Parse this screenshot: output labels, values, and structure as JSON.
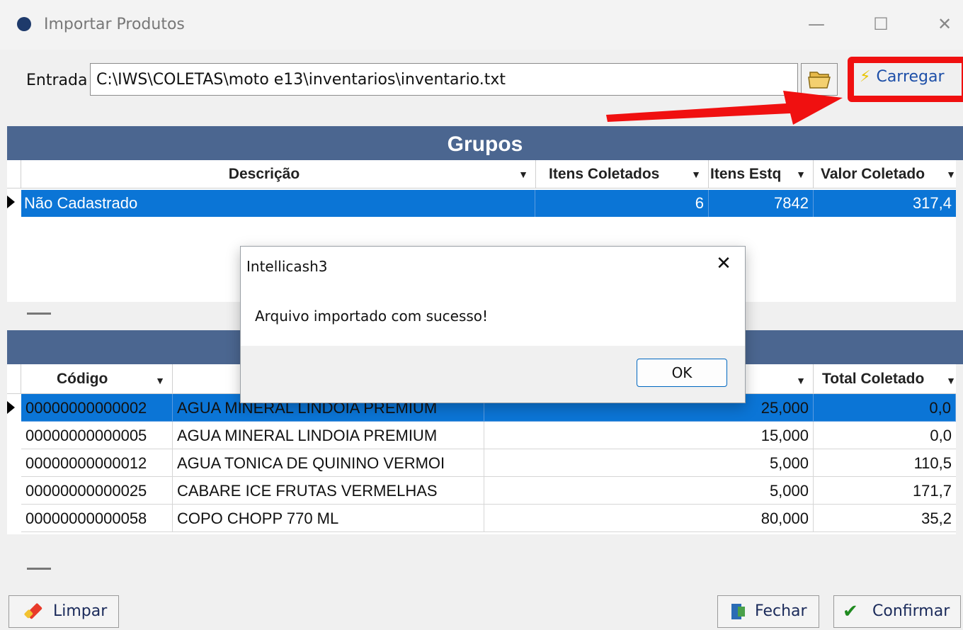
{
  "window": {
    "title": "Importar Produtos",
    "min": "—",
    "max": "☐",
    "close": "✕"
  },
  "entrada": {
    "label": "Entrada",
    "value": "C:\\IWS\\COLETAS\\moto e13\\inventarios\\inventario.txt",
    "load_label": "Carregar"
  },
  "grupos": {
    "title": "Grupos",
    "columns": [
      "Descrição",
      "Itens Coletados",
      "Itens Estq",
      "Valor Coletado"
    ],
    "rows": [
      {
        "descricao": "Não Cadastrado",
        "itens_coletados": "6",
        "itens_estq": "7842",
        "valor_coletado": "317,4"
      }
    ]
  },
  "produtos": {
    "columns": [
      "Código",
      "Total Coletado"
    ],
    "rows": [
      {
        "codigo": "00000000000002",
        "descricao": "AGUA MINERAL LINDOIA PREMIUM",
        "qtd": "25,000",
        "total": "0,0"
      },
      {
        "codigo": "00000000000005",
        "descricao": "AGUA MINERAL LINDOIA PREMIUM",
        "qtd": "15,000",
        "total": "0,0"
      },
      {
        "codigo": "00000000000012",
        "descricao": "AGUA TONICA DE QUININO VERMOI",
        "qtd": "5,000",
        "total": "110,5"
      },
      {
        "codigo": "00000000000025",
        "descricao": "CABARE ICE FRUTAS VERMELHAS",
        "qtd": "5,000",
        "total": "171,7"
      },
      {
        "codigo": "00000000000058",
        "descricao": "COPO CHOPP 770 ML",
        "qtd": "80,000",
        "total": "35,2"
      }
    ]
  },
  "buttons": {
    "limpar": "Limpar",
    "fechar": "Fechar",
    "confirmar": "Confirmar"
  },
  "dialog": {
    "title": "Intellicash3",
    "message": "Arquivo importado com sucesso!",
    "ok": "OK",
    "close": "✕"
  },
  "colors": {
    "header_blue": "#4b6690",
    "selection_blue": "#0b75d6",
    "highlight_red": "#f01010"
  }
}
